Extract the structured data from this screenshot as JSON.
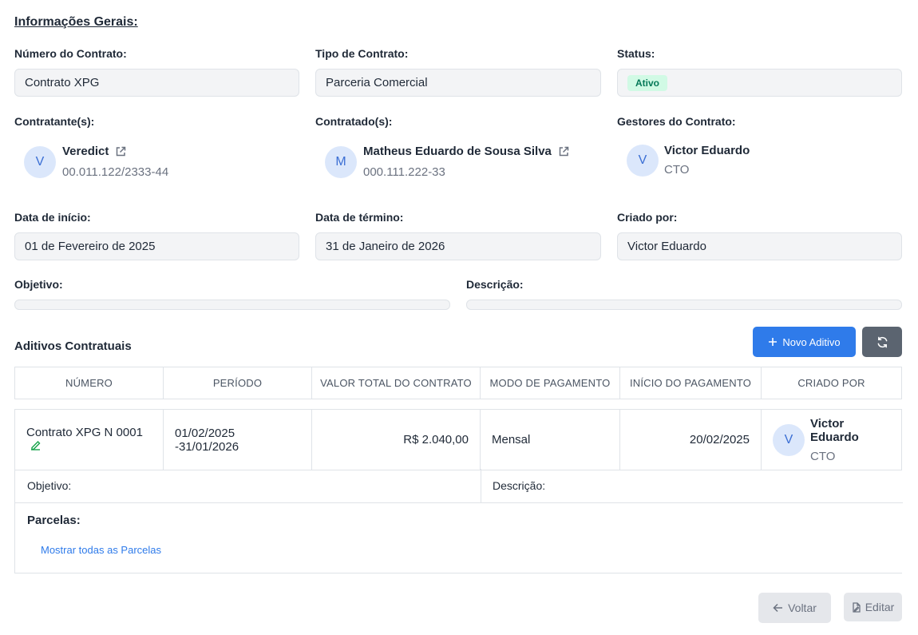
{
  "general": {
    "title": "Informações Gerais:",
    "contract_number": {
      "label": "Número do Contrato:",
      "value": "Contrato XPG"
    },
    "contract_type": {
      "label": "Tipo de Contrato:",
      "value": "Parceria Comercial"
    },
    "status": {
      "label": "Status:",
      "value": "Ativo"
    },
    "contractors": {
      "label": "Contratante(s):",
      "items": [
        {
          "initial": "V",
          "name": "Veredict",
          "doc": "00.011.122/2333-44"
        }
      ]
    },
    "contracted": {
      "label": "Contratado(s):",
      "items": [
        {
          "initial": "M",
          "name": "Matheus Eduardo de Sousa Silva",
          "doc": "000.111.222-33"
        }
      ]
    },
    "managers": {
      "label": "Gestores do Contrato:",
      "items": [
        {
          "initial": "V",
          "name": "Victor Eduardo",
          "role": "CTO"
        }
      ]
    },
    "start_date": {
      "label": "Data de início:",
      "value": "01 de Fevereiro de 2025"
    },
    "end_date": {
      "label": "Data de término:",
      "value": "31 de Janeiro de 2026"
    },
    "created_by": {
      "label": "Criado por:",
      "value": "Victor Eduardo"
    },
    "objective": {
      "label": "Objetivo:",
      "value": ""
    },
    "description": {
      "label": "Descrição:",
      "value": ""
    }
  },
  "amendments": {
    "title": "Aditivos Contratuais",
    "new_button": "Novo Aditivo",
    "columns": [
      "NÚMERO",
      "PERÍODO",
      "VALOR TOTAL DO CONTRATO",
      "MODO DE PAGAMENTO",
      "INÍCIO DO PAGAMENTO",
      "CRIADO POR"
    ],
    "rows": [
      {
        "number": "Contrato XPG N 0001",
        "period": "01/02/2025 -31/01/2026",
        "total": "R$ 2.040,00",
        "payment_mode": "Mensal",
        "payment_start": "20/02/2025",
        "creator": {
          "initial": "V",
          "name": "Victor Eduardo",
          "role": "CTO"
        },
        "objective_label": "Objetivo:",
        "description_label": "Descrição:",
        "installments_label": "Parcelas:",
        "show_all_link": "Mostrar todas as Parcelas"
      }
    ]
  },
  "footer": {
    "back": "Voltar",
    "edit": "Editar"
  },
  "colors": {
    "primary": "#2f7bea",
    "secondary": "#5b6470",
    "status_bg": "#d1fae5",
    "status_text": "#047857",
    "edit_icon": "#16a34a"
  }
}
